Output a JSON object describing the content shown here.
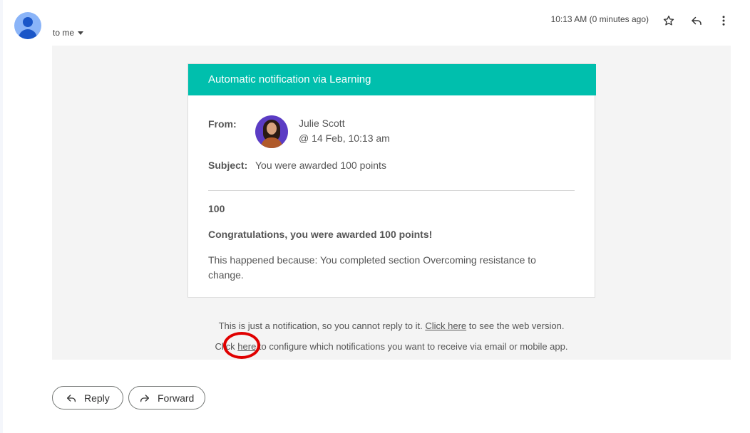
{
  "header": {
    "recipient_label": "to me",
    "timestamp": "10:13 AM (0 minutes ago)"
  },
  "icons": {
    "sender_avatar": "person-icon",
    "star": "star-icon",
    "reply": "reply-icon",
    "more": "more-vert-icon",
    "recipient_toggle": "caret-down-icon",
    "forward": "forward-icon"
  },
  "card": {
    "header_title": "Automatic notification via Learning",
    "from_label": "From:",
    "from_name": "Julie Scott",
    "from_date": "@ 14 Feb, 10:13 am",
    "subject_label": "Subject:",
    "subject_text": "You were awarded 100 points",
    "points_value": "100",
    "congrats": "Congratulations, you were awarded 100 points!",
    "reason": "This happened because: You completed section Overcoming resistance to change."
  },
  "footer": {
    "line1_prefix": "This is just a notification, so you cannot reply to it. ",
    "line1_link": "Click here",
    "line1_suffix": " to see the web version.",
    "line2_prefix": "Click ",
    "line2_link": "here",
    "line2_suffix": " to configure which notifications you want to receive via email or mobile app."
  },
  "actions": {
    "reply_label": "Reply",
    "forward_label": "Forward"
  },
  "colors": {
    "accent_header": "#00bfad",
    "annotation_circle": "#e00000",
    "body_background": "#f4f4f4"
  }
}
